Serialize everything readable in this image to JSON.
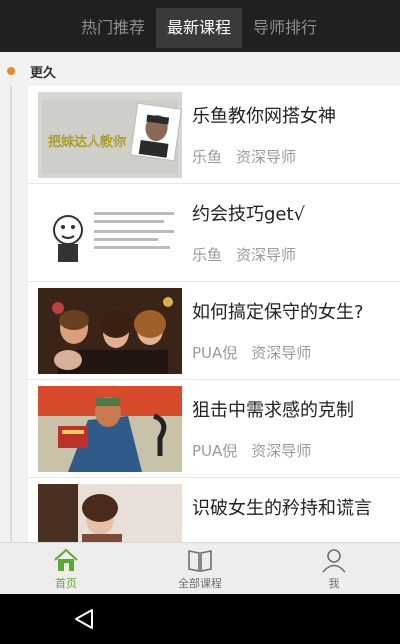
{
  "top_tabs": [
    {
      "label": "热门推荐"
    },
    {
      "label": "最新课程"
    },
    {
      "label": "导师排行"
    }
  ],
  "active_tab": "最新课程",
  "section": {
    "label": "更久"
  },
  "courses": [
    {
      "title": "乐鱼教你网搭女神",
      "author": "乐鱼",
      "role": "资深导师",
      "thumb_caption": "把妹达人教你"
    },
    {
      "title": "约会技巧get√",
      "author": "乐鱼",
      "role": "资深导师",
      "thumb_caption": ""
    },
    {
      "title": "如何搞定保守的女生?",
      "author": "PUA倪",
      "role": "资深导师",
      "thumb_caption": ""
    },
    {
      "title": "狙击中需求感的克制",
      "author": "PUA倪",
      "role": "资深导师",
      "thumb_caption": ""
    },
    {
      "title": "识破女生的矜持和谎言",
      "author": "",
      "role": "",
      "thumb_caption": ""
    }
  ],
  "bottom_nav": [
    {
      "label": "首页",
      "icon": "home-icon"
    },
    {
      "label": "全部课程",
      "icon": "book-icon"
    },
    {
      "label": "我",
      "icon": "user-icon"
    }
  ],
  "colors": {
    "accent": "#5aaa2e",
    "timeline_dot": "#f08a1c",
    "topbar": "#202020"
  },
  "system_nav": {
    "icon": "back-triangle-icon"
  }
}
